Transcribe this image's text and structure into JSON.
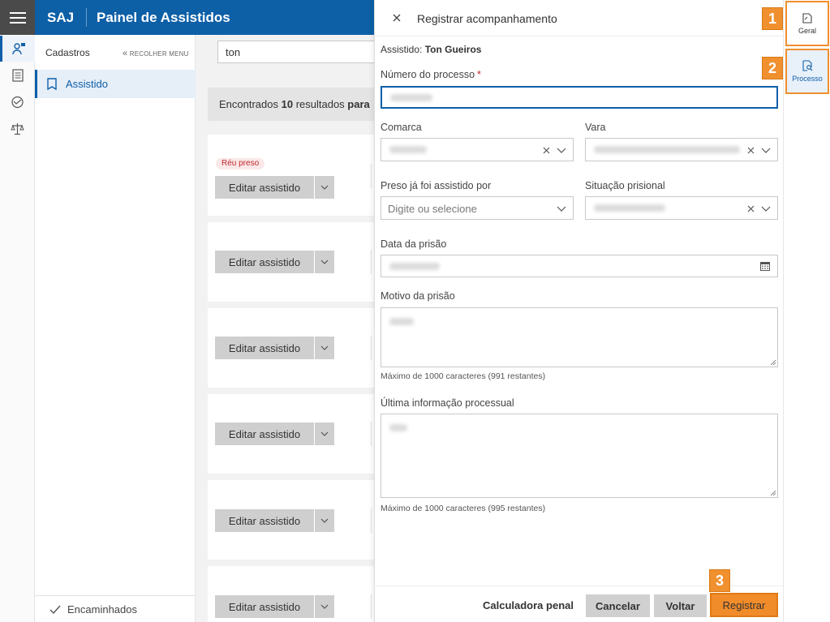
{
  "topbar": {
    "brand": "SAJ",
    "title": "Painel de Assistidos"
  },
  "menu": {
    "title": "Cadastros",
    "collapse_label": "RECOLHER MENU",
    "item_label": "Assistido",
    "footer_label": "Encaminhados"
  },
  "main": {
    "search_value": "ton",
    "found_prefix": "Encontrados ",
    "found_count": "10",
    "found_mid": " resultados ",
    "found_suffix": "para",
    "badge": "Réu preso",
    "edit_label": "Editar assistido"
  },
  "drawer": {
    "title": "Registrar acompanhamento",
    "assistido_label": "Assistido:",
    "assistido_name": "Ton Gueiros",
    "numero_label": "Número do processo",
    "required_mark": "*",
    "comarca_label": "Comarca",
    "vara_label": "Vara",
    "preso_label": "Preso já foi assistido por",
    "preso_placeholder": "Digite ou selecione",
    "situacao_label": "Situação prisional",
    "data_label": "Data da prisão",
    "motivo_label": "Motivo da prisão",
    "motivo_hint": "Máximo de 1000 caracteres (991 restantes)",
    "ultima_label": "Última informação processual",
    "ultima_hint": "Máximo de 1000 caracteres (995 restantes)",
    "calc_label": "Calculadora penal",
    "cancel_label": "Cancelar",
    "back_label": "Voltar",
    "submit_label": "Registrar"
  },
  "rrail": {
    "geral_label": "Geral",
    "processo_label": "Processo"
  },
  "steps": {
    "one": "1",
    "two": "2",
    "three": "3"
  },
  "colors": {
    "primary": "#0d5fa6",
    "accent": "#f0902e",
    "badge": "#c0272d"
  }
}
